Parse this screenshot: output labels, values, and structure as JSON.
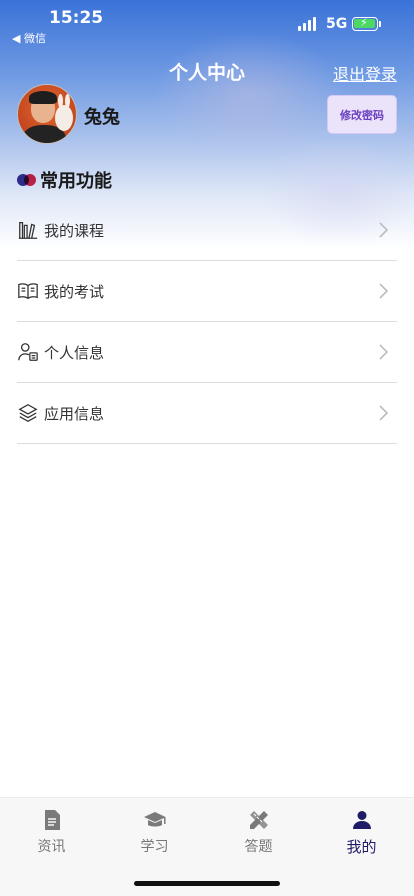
{
  "status_bar": {
    "time": "15:25",
    "back_app": "◀ 微信",
    "network": "5G"
  },
  "header": {
    "title": "个人中心",
    "logout_label": "退出登录"
  },
  "profile": {
    "username": "兔兔",
    "change_password_label": "修改密码"
  },
  "section": {
    "title": "常用功能"
  },
  "menu": {
    "items": [
      {
        "label": "我的课程",
        "icon": "books-icon"
      },
      {
        "label": "我的考试",
        "icon": "open-book-icon"
      },
      {
        "label": "个人信息",
        "icon": "user-card-icon"
      },
      {
        "label": "应用信息",
        "icon": "layers-icon"
      }
    ]
  },
  "tabbar": {
    "tabs": [
      {
        "label": "资讯",
        "icon": "document-icon",
        "active": false
      },
      {
        "label": "学习",
        "icon": "graduation-cap-icon",
        "active": false
      },
      {
        "label": "答题",
        "icon": "pencil-ruler-icon",
        "active": false
      },
      {
        "label": "我的",
        "icon": "person-icon",
        "active": true
      }
    ]
  },
  "colors": {
    "header_gradient_top": "#3a72d8",
    "accent_purple": "#6a3fc0",
    "tab_active": "#1f1b66",
    "tab_inactive": "#777777"
  }
}
